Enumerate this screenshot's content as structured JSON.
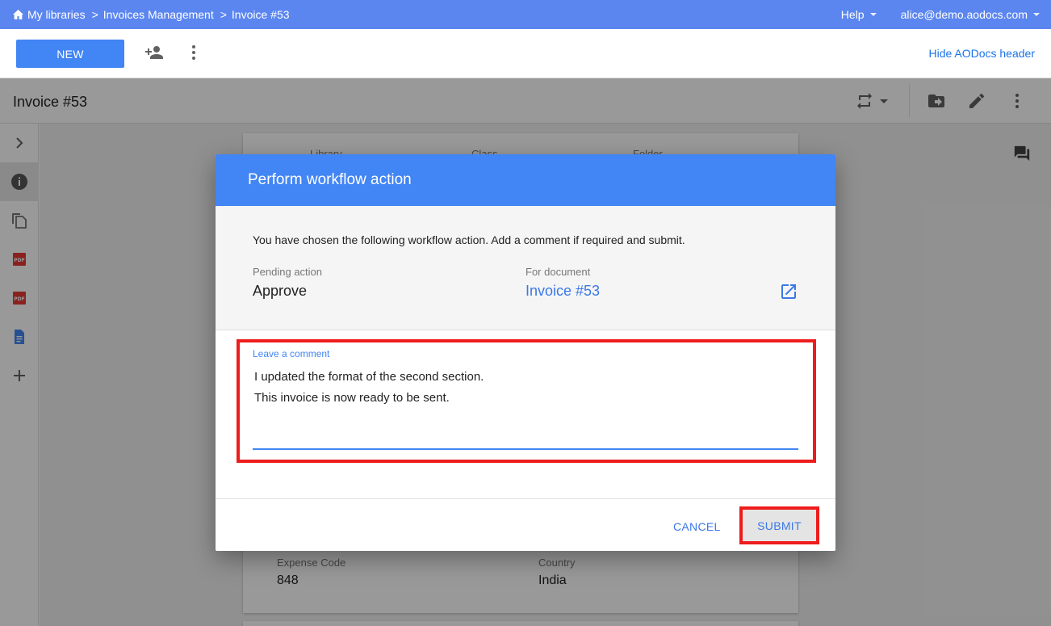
{
  "breadcrumb": {
    "items": [
      "My libraries",
      "Invoices Management",
      "Invoice #53"
    ],
    "separator": ">"
  },
  "topbar": {
    "help_label": "Help",
    "user_email": "alice@demo.aodocs.com"
  },
  "toolbar": {
    "new_label": "NEW",
    "hide_header_label": "Hide AODocs header"
  },
  "document": {
    "title": "Invoice #53",
    "fields_top": [
      "Library",
      "Class",
      "Folder"
    ],
    "fields": [
      {
        "label": "Expense Code",
        "value": "848"
      },
      {
        "label": "Country",
        "value": "India"
      }
    ]
  },
  "dialog": {
    "title": "Perform workflow action",
    "intro": "You have chosen the following workflow action. Add a comment if required and submit.",
    "pending_action_label": "Pending action",
    "pending_action_value": "Approve",
    "for_document_label": "For document",
    "for_document_value": "Invoice #53",
    "comment_label": "Leave a comment",
    "comment_text": "I updated the format of the second section.\nThis invoice is now ready to be sent.",
    "cancel_label": "CANCEL",
    "submit_label": "SUBMIT"
  },
  "colors": {
    "topbar": "#5b86f0",
    "primary": "#4285f4",
    "link": "#3b78e7",
    "highlight": "#ee1c1c"
  },
  "icons": [
    "home-icon",
    "add-person-icon",
    "more-vert-icon",
    "sync-icon",
    "move-to-folder-icon",
    "edit-icon",
    "chevron-right-icon",
    "info-icon",
    "copy-icon",
    "pdf-icon",
    "doc-icon",
    "add-icon",
    "comment-icon",
    "open-in-new-icon"
  ]
}
